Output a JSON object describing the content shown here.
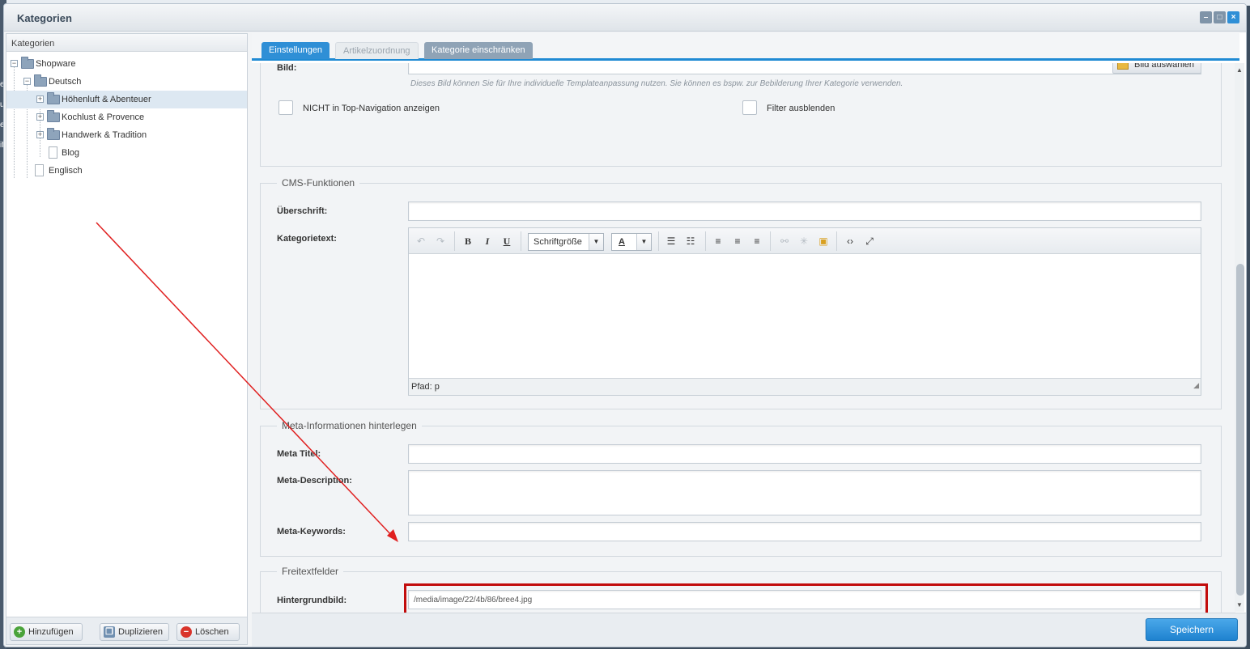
{
  "window": {
    "title": "Kategorien",
    "tools": [
      "–",
      "□",
      "×"
    ]
  },
  "sidebar": {
    "header": "Kategorien",
    "tree": [
      {
        "label": "Shopware",
        "level": 0,
        "type": "folder",
        "expander": "−"
      },
      {
        "label": "Deutsch",
        "level": 1,
        "type": "folder",
        "expander": "−"
      },
      {
        "label": "Höhenluft & Abenteuer",
        "level": 2,
        "type": "folder",
        "expander": "+",
        "selected": true
      },
      {
        "label": "Kochlust & Provence",
        "level": 2,
        "type": "folder",
        "expander": "+"
      },
      {
        "label": "Handwerk & Tradition",
        "level": 2,
        "type": "folder",
        "expander": "+"
      },
      {
        "label": "Blog",
        "level": 2,
        "type": "file"
      },
      {
        "label": "Englisch",
        "level": 1,
        "type": "file"
      }
    ],
    "buttons": {
      "add": "Hinzufügen",
      "duplicate": "Duplizieren",
      "delete": "Löschen"
    }
  },
  "tabs": [
    {
      "label": "Einstellungen",
      "state": "active"
    },
    {
      "label": "Artikelzuordnung",
      "state": "disabled"
    },
    {
      "label": "Kategorie einschränken",
      "state": "normal"
    }
  ],
  "settings": {
    "image_label": "Bild:",
    "image_button": "Bild auswählen",
    "image_hint": "Dieses Bild können Sie für Ihre individuelle Templateanpassung nutzen. Sie können es bspw. zur Bebilderung Ihrer Kategorie verwenden.",
    "hide_top_nav": "NICHT in Top-Navigation anzeigen",
    "hide_filter": "Filter ausblenden"
  },
  "cms": {
    "legend": "CMS-Funktionen",
    "heading_label": "Überschrift:",
    "text_label": "Kategorietext:",
    "font_size": "Schriftgröße",
    "font_color_glyph": "A",
    "status": "Pfad: p"
  },
  "meta": {
    "legend": "Meta-Informationen hinterlegen",
    "title_label": "Meta Titel:",
    "description_label": "Meta-Description:",
    "keywords_label": "Meta-Keywords:"
  },
  "freetext": {
    "legend": "Freitextfelder",
    "bg_label": "Hintergrundbild:",
    "bg_value": "/media/image/22/4b/86/bree4.jpg"
  },
  "footer": {
    "save": "Speichern"
  },
  "colors": {
    "accent": "#2f8fd6",
    "annotation": "#c20c0c"
  },
  "backdrop_letters": [
    "e",
    "u",
    "e",
    "if"
  ]
}
